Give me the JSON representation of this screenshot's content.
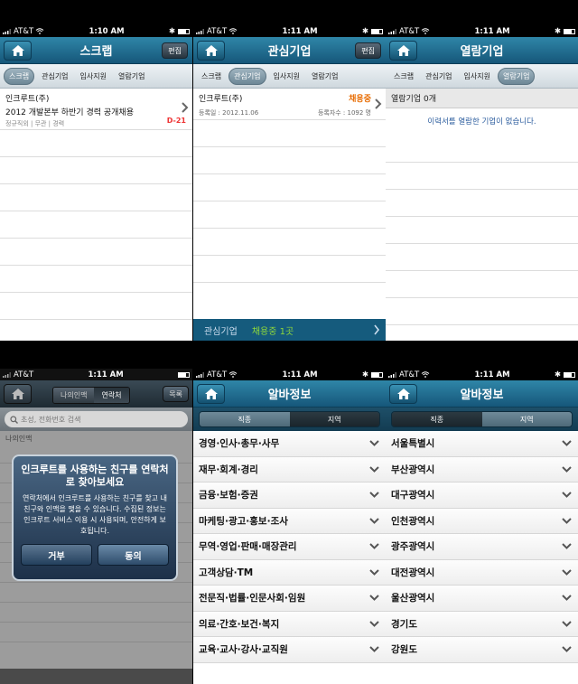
{
  "status": {
    "carrier": "AT&T",
    "time_a": "1:10 AM",
    "time_b": "1:11 AM"
  },
  "scrap": {
    "title": "스크랩",
    "edit_label": "편집",
    "tabs": [
      "스크랩",
      "관심기업",
      "입사지원",
      "열람기업"
    ],
    "item": {
      "company": "인크루트(주)",
      "job_title": "2012 개발본부 하반기 경력 공개채용",
      "meta": "정규직외 | 무관 | 경력",
      "dday": "D-21"
    }
  },
  "interest": {
    "title": "관심기업",
    "edit_label": "편집",
    "tabs": [
      "스크랩",
      "관심기업",
      "입사지원",
      "열람기업"
    ],
    "item": {
      "company": "인크루트(주)",
      "hiring_status": "채용중",
      "registered": "등록일 : 2012.11.06",
      "count": "등록자수 : 1092 명"
    },
    "footer": {
      "label": "관심기업",
      "value": "채용중 1곳"
    }
  },
  "viewed": {
    "title": "열람기업",
    "tabs": [
      "스크랩",
      "관심기업",
      "입사지원",
      "열람기업"
    ],
    "section": "열람기업 0개",
    "empty_message": "이력서를 열람한 기업이 없습니다."
  },
  "contacts": {
    "seg": [
      "나의인맥",
      "연락처"
    ],
    "edit_label": "목록",
    "search_placeholder": "초성, 전화번호 검색",
    "list_header": "나의인맥",
    "alert": {
      "title": "인크루트를 사용하는 친구를 연락처로 찾아보세요",
      "body": "연락처에서 인크루트를 사용하는 친구를 찾고 내 친구와 인맥을 맺을 수 있습니다. 수집된 정보는 인크루트 서비스 이용 시 사용되며, 안전하게 보호됩니다.",
      "cancel": "거부",
      "ok": "동의"
    }
  },
  "alba_job": {
    "title": "알바정보",
    "seg": [
      "직종",
      "지역"
    ],
    "categories": [
      "경영·인사·총무·사무",
      "재무·회계·경리",
      "금융·보험·증권",
      "마케팅·광고·홍보·조사",
      "무역·영업·판매·매장관리",
      "고객상담·TM",
      "전문직·법률·인문사회·임원",
      "의료·간호·보건·복지",
      "교육·교사·강사·교직원"
    ]
  },
  "alba_region": {
    "title": "알바정보",
    "seg": [
      "직종",
      "지역"
    ],
    "regions": [
      "서울특별시",
      "부산광역시",
      "대구광역시",
      "인천광역시",
      "광주광역시",
      "대전광역시",
      "울산광역시",
      "경기도",
      "강원도"
    ]
  },
  "colors": {
    "navbar": "#16577a",
    "accent_orange": "#e86b00",
    "dday_red": "#e33333",
    "footer_green": "#8fd93b"
  },
  "icons": [
    "home-icon",
    "chevron-right-icon",
    "chevron-down-icon",
    "search-icon",
    "wifi-icon",
    "battery-icon",
    "signal-icon",
    "bluetooth-icon"
  ]
}
